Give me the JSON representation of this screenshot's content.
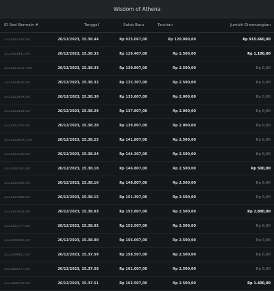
{
  "window": {
    "title": "Wisdom of Athena"
  },
  "columns": [
    "ID Sesi Bermain #",
    "Tanggal",
    "Saldo Baru",
    "Taruhan",
    "Jumlah Dimenangkan"
  ],
  "rows": [
    {
      "id": "3221413765104",
      "date": "26/12/2023, 15.38.44",
      "balance": "Rp 925.067,00",
      "bet": "Rp 120.000,00",
      "win": "Rp 915.660,00",
      "won": true
    },
    {
      "id": "3221413841104",
      "date": "26/12/2023, 15.38.35",
      "balance": "Rp 129.407,00",
      "bet": "Rp 2.500,00",
      "win": "Rp 1.100,00",
      "won": true
    },
    {
      "id": "32214131107104",
      "date": "26/12/2023, 15.38.33",
      "balance": "Rp 130.807,00",
      "bet": "Rp 2.500,00",
      "win": "Rp 0,00",
      "won": false
    },
    {
      "id": "3221413026104",
      "date": "26/12/2023, 15.38.32",
      "balance": "Rp 133.307,00",
      "bet": "Rp 2.500,00",
      "win": "Rp 0,00",
      "won": false
    },
    {
      "id": "3221412929104",
      "date": "26/12/2023, 15.38.30",
      "balance": "Rp 135.807,00",
      "bet": "Rp 2.000,00",
      "win": "Rp 0,00",
      "won": false
    },
    {
      "id": "3221412849104",
      "date": "26/12/2023, 15.38.29",
      "balance": "Rp 137.807,00",
      "bet": "Rp 2.000,00",
      "win": "Rp 0,00",
      "won": false
    },
    {
      "id": "3221412765104",
      "date": "26/12/2023, 15.38.28",
      "balance": "Rp 139.807,00",
      "bet": "Rp 2.000,00",
      "win": "Rp 0,00",
      "won": false
    },
    {
      "id": "32214126191104",
      "date": "26/12/2023, 15.38.25",
      "balance": "Rp 141.807,00",
      "bet": "Rp 2.500,00",
      "win": "Rp 0,00",
      "won": false
    },
    {
      "id": "3221412536104",
      "date": "26/12/2023, 15.38.24",
      "balance": "Rp 144.307,00",
      "bet": "Rp 2.500,00",
      "win": "Rp 0,00",
      "won": false
    },
    {
      "id": "3221412182104",
      "date": "26/12/2023, 15.38.18",
      "balance": "Rp 146.807,00",
      "bet": "Rp 2.500,00",
      "win": "Rp 500,00",
      "won": true
    },
    {
      "id": "3221412066104",
      "date": "26/12/2023, 15.38.16",
      "balance": "Rp 148.807,00",
      "bet": "Rp 2.500,00",
      "win": "Rp 0,00",
      "won": false
    },
    {
      "id": "3221411980104",
      "date": "26/12/2023, 15.38.15",
      "balance": "Rp 151.307,00",
      "bet": "Rp 2.500,00",
      "win": "Rp 0,00",
      "won": false
    },
    {
      "id": "3221412654104",
      "date": "26/12/2023, 15.38.03",
      "balance": "Rp 153.807,00",
      "bet": "Rp 2.500,00",
      "win": "Rp 2.800,00",
      "won": true
    },
    {
      "id": "3221411777104",
      "date": "26/12/2023, 15.38.02",
      "balance": "Rp 153.507,00",
      "bet": "Rp 2.500,00",
      "win": "Rp 0,00",
      "won": false
    },
    {
      "id": "3221410684104",
      "date": "26/12/2023, 15.38.00",
      "balance": "Rp 156.007,00",
      "bet": "Rp 2.500,00",
      "win": "Rp 0,00",
      "won": false
    },
    {
      "id": "3221409951104",
      "date": "26/12/2023, 15.37.59",
      "balance": "Rp 158.507,00",
      "bet": "Rp 2.500,00",
      "win": "Rp 0,00",
      "won": false
    },
    {
      "id": "3221409227104",
      "date": "26/12/2023, 15.37.58",
      "balance": "Rp 161.007,00",
      "bet": "Rp 2.500,00",
      "win": "Rp 0,00",
      "won": false
    },
    {
      "id": "3221408750104",
      "date": "26/12/2023, 15.37.51",
      "balance": "Rp 163.507,00",
      "bet": "Rp 2.500,00",
      "win": "Rp 1.400,00",
      "won": true
    }
  ]
}
